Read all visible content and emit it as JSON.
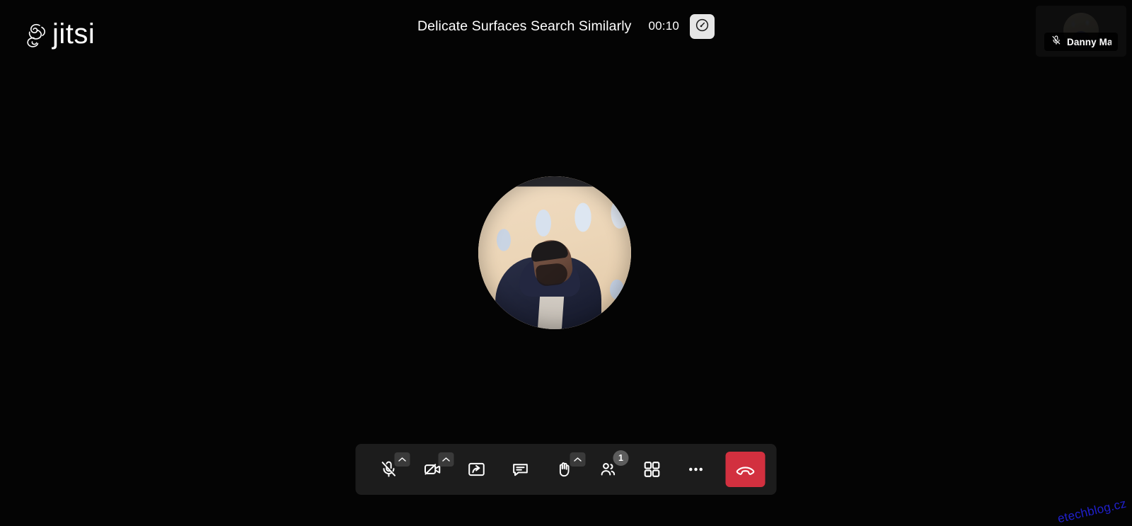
{
  "app": {
    "brand_name": "jitsi",
    "brand_mark_icon": "jitsi-swirl-icon",
    "background_color": "#040404"
  },
  "header": {
    "meeting_title": "Delicate Surfaces Search Similarly",
    "timer": "00:10",
    "quality_button": {
      "icon": "connection-quality-gauge-icon",
      "background_color": "#E6E6E6"
    }
  },
  "stage": {
    "active_speaker_avatar": {
      "icon": "participant-avatar-photo",
      "description": "man in navy jacket in front of beige building"
    }
  },
  "filmstrip": {
    "participants": [
      {
        "name": "Danny Ma...",
        "muted": true,
        "mute_icon": "microphone-muted-icon",
        "avatar_icon": "participant-avatar-thumbnail"
      }
    ]
  },
  "toolbar": {
    "background_color": "#1C1C1C",
    "buttons": [
      {
        "name": "microphone",
        "label": "Unmute / Mute",
        "icon": "microphone-muted-icon",
        "has_dropdown": true,
        "state": "muted"
      },
      {
        "name": "camera",
        "label": "Start / Stop camera",
        "icon": "camera-disabled-icon",
        "has_dropdown": true,
        "state": "disabled"
      },
      {
        "name": "screen-share",
        "label": "Share your screen",
        "icon": "screen-share-icon",
        "has_dropdown": false,
        "state": "default"
      },
      {
        "name": "chat",
        "label": "Open chat",
        "icon": "chat-bubble-icon",
        "has_dropdown": false,
        "state": "default"
      },
      {
        "name": "raise-hand",
        "label": "Raise your hand",
        "icon": "raised-hand-icon",
        "has_dropdown": true,
        "state": "default"
      },
      {
        "name": "participants",
        "label": "Participants",
        "icon": "participants-icon",
        "has_dropdown": false,
        "badge": "1",
        "state": "default"
      },
      {
        "name": "tile-view",
        "label": "Toggle tile view",
        "icon": "tile-view-icon",
        "has_dropdown": false,
        "state": "default"
      },
      {
        "name": "more-options",
        "label": "More actions",
        "icon": "more-horizontal-icon",
        "has_dropdown": false,
        "state": "default"
      }
    ],
    "hangup": {
      "label": "Leave the meeting",
      "icon": "hangup-phone-icon",
      "color": "#D2303F"
    },
    "badge_color": "#5C5C5C",
    "chevron_color": "#3A3A3A"
  },
  "watermark": {
    "text": "etechblog.cz",
    "color": "#2222d8"
  }
}
